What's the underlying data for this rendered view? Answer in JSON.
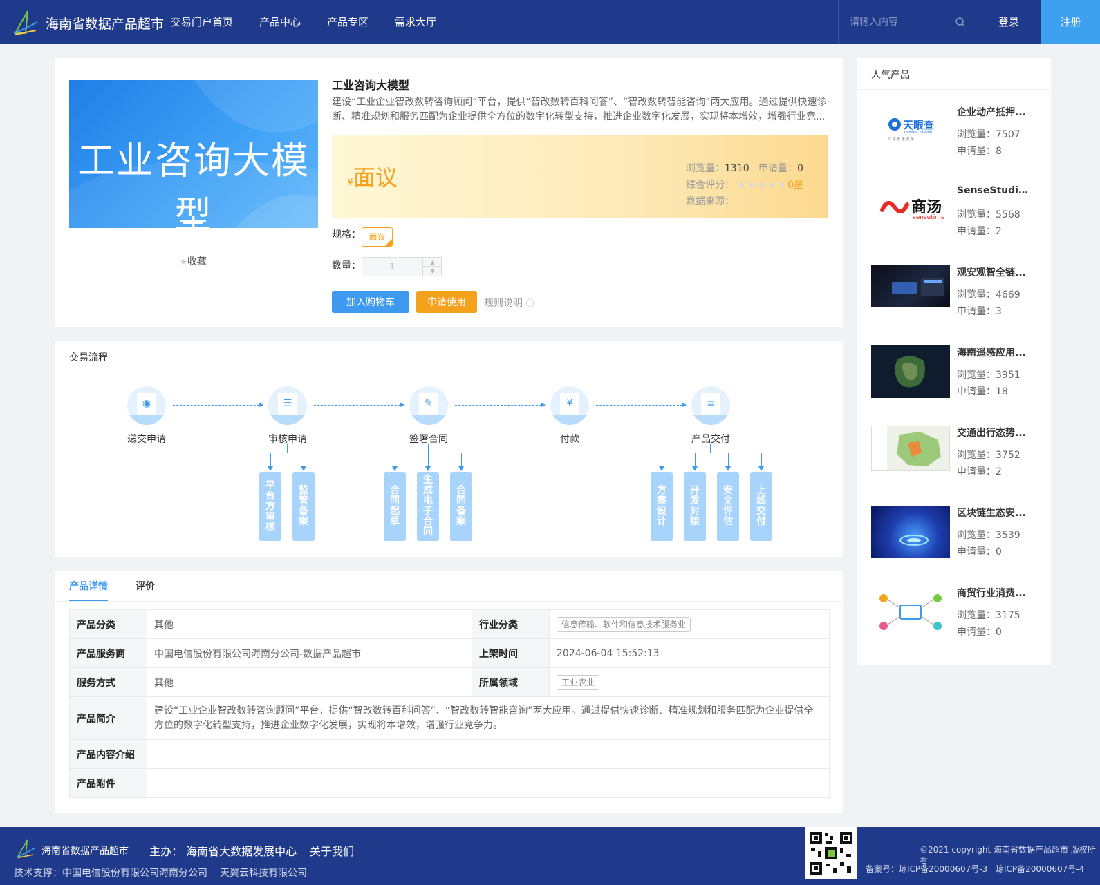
{
  "header": {
    "brand": "海南省数据产品超市",
    "nav": [
      "交易门户首页",
      "产品中心",
      "产品专区",
      "需求大厅"
    ],
    "search_placeholder": "请输入内容",
    "login": "登录",
    "register": "注册"
  },
  "product": {
    "banner_text": "工业咨询大模型",
    "favorite": "收藏",
    "title": "工业咨询大模型",
    "description": "建设“工业企业智改数转咨询顾问”平台，提供“智改数转百科问答”、“智改数转智能咨询”两大应用。通过提供快速诊断、精准规划和服务匹配为企业提供全方位的数字化转型支持，推进企业数字化发展，实现将本增效，增强行业竞...",
    "currency": "¥",
    "price": "面议",
    "views_label": "浏览量：",
    "views": "1310",
    "applies_label": "申请量：",
    "applies": "0",
    "rating_label": "综合评分：",
    "rating_value": "0星",
    "rating": 0,
    "source_label": "数据来源：",
    "source": "",
    "spec_label": "规格：",
    "spec_value": "面议",
    "qty_label": "数量：",
    "qty_value": "1",
    "add_cart": "加入购物车",
    "apply": "申请使用",
    "rules": "规则说明"
  },
  "flow": {
    "title": "交易流程",
    "steps": [
      "递交申请",
      "审核申请",
      "签署合同",
      "付款",
      "产品交付"
    ],
    "sub": {
      "review": [
        "平台方审核",
        "监管备案"
      ],
      "contract": [
        "合同起草",
        "生成电子合同",
        "合同备案"
      ],
      "deliver": [
        "方案设计",
        "开发对接",
        "安全评估",
        "上线交付"
      ]
    }
  },
  "detail": {
    "tabs": [
      "产品详情",
      "评价"
    ],
    "rows": {
      "category_k": "产品分类",
      "category_v": "其他",
      "industry_k": "行业分类",
      "industry_v": "信息传输、软件和信息技术服务业",
      "provider_k": "产品服务商",
      "provider_v": "中国电信股份有限公司海南分公司-数据产品超市",
      "listed_k": "上架时间",
      "listed_v": "2024-06-04 15:52:13",
      "service_k": "服务方式",
      "service_v": "其他",
      "domain_k": "所属领域",
      "domain_v": "工业农业",
      "intro_k": "产品简介",
      "intro_v": "建设“工业企业智改数转咨询顾问”平台，提供“智改数转百科问答”、“智改数转智能咨询”两大应用。通过提供快速诊断、精准规划和服务匹配为企业提供全方位的数字化转型支持，推进企业数字化发展，实现将本增效，增强行业竞争力。",
      "content_k": "产品内容介绍",
      "content_v": "",
      "attach_k": "产品附件",
      "attach_v": ""
    }
  },
  "sidebar": {
    "title": "人气产品",
    "view_label": "浏览量：",
    "apply_label": "申请量：",
    "items": [
      {
        "name": "企业动产抵押...",
        "views": "7507",
        "applies": "8",
        "thumb": "tianyancha"
      },
      {
        "name": "SenseStudio...",
        "views": "5568",
        "applies": "2",
        "thumb": "sensetime"
      },
      {
        "name": "观安观智全链...",
        "views": "4669",
        "applies": "3",
        "thumb": "dark-tech"
      },
      {
        "name": "海南遥感应用...",
        "views": "3951",
        "applies": "18",
        "thumb": "satellite"
      },
      {
        "name": "交通出行态势...",
        "views": "3752",
        "applies": "2",
        "thumb": "map"
      },
      {
        "name": "区块链生态安...",
        "views": "3539",
        "applies": "0",
        "thumb": "blockchain"
      },
      {
        "name": "商贸行业消费...",
        "views": "3175",
        "applies": "0",
        "thumb": "network"
      }
    ],
    "logo_texts": {
      "tyc_cn": "天眼查",
      "tyc_en": "TianYanCha.com",
      "tyc_slogan": "公 平 普 惠 财 务",
      "st_cn": "商汤",
      "st_en": "sensetime"
    }
  },
  "footer": {
    "brand": "海南省数据产品超市",
    "host": "主办： 海南省大数据发展中心",
    "about": "关于我们",
    "tech": "技术支撑：中国电信股份有限公司海南分公司",
    "tech2": "天翼云科技有限公司",
    "copyright": "©2021 copyright 海南省数据产品超市 版权所有",
    "icp1": "备案号：琼ICP备20000607号-3",
    "icp2": "琼ICP备20000607号-4"
  },
  "colors": {
    "header_bg": "#1f3a8a",
    "accent_blue": "#3d9af0",
    "accent_orange": "#f5a11c",
    "register_bg": "#3ea1ef"
  }
}
